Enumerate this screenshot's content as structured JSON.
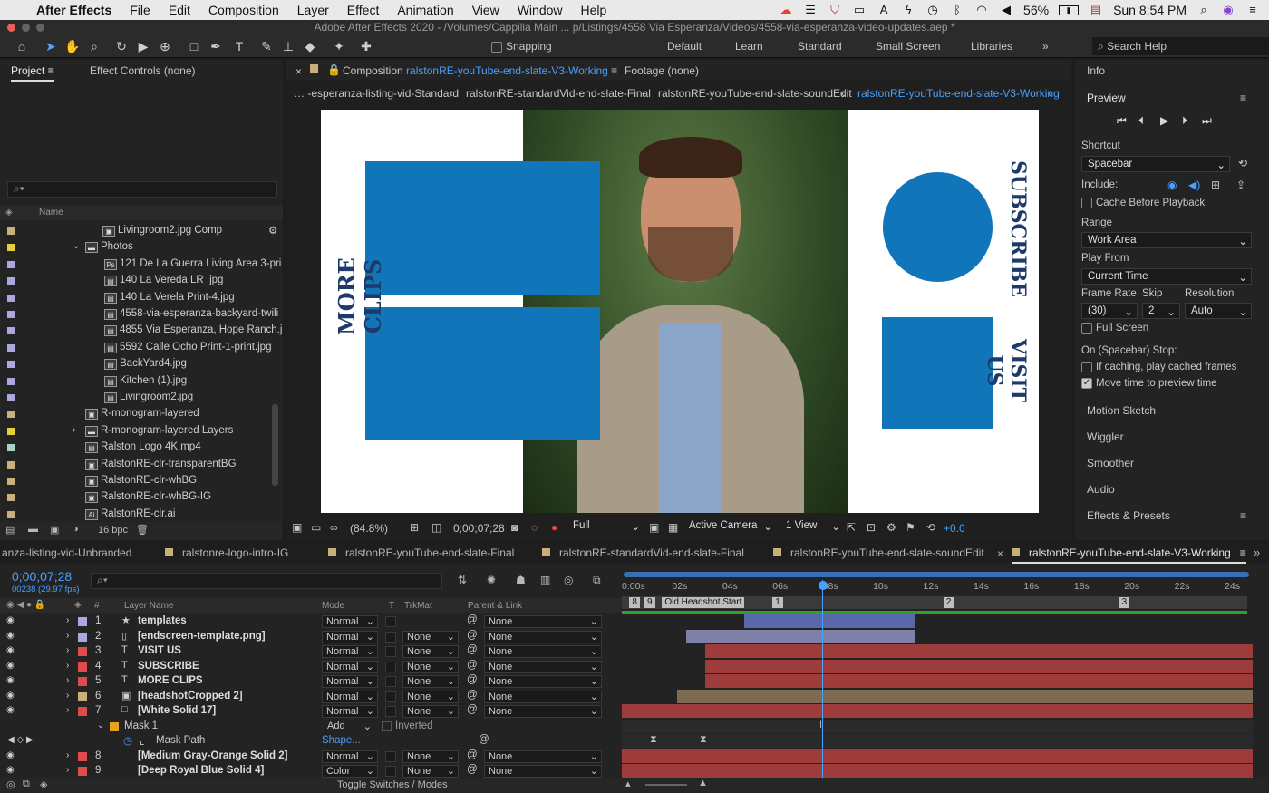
{
  "menubar": {
    "app": "After Effects",
    "items": [
      "File",
      "Edit",
      "Composition",
      "Layer",
      "Effect",
      "Animation",
      "View",
      "Window",
      "Help"
    ],
    "battery": "56%",
    "clock": "Sun 8:54 PM"
  },
  "window_title": "Adobe After Effects 2020 - /Volumes/Cappilla Main ... p/Listings/4558 Via Esperanza/Videos/4558-via-esperanza-video-updates.aep *",
  "toolbar": {
    "snapping": "Snapping",
    "workspaces": [
      "Default",
      "Learn",
      "Standard",
      "Small Screen",
      "Libraries"
    ],
    "search_help": "Search Help"
  },
  "project_panel": {
    "tab_project": "Project",
    "tab_effect_controls": "Effect Controls (none)",
    "col_name": "Name",
    "bpc": "16 bpc",
    "items": [
      {
        "name": "Livingroom2.jpg Comp",
        "color": "#c9b07a",
        "type": "comp",
        "indent": 1
      },
      {
        "name": "Photos",
        "color": "#e6cf3c",
        "type": "folder",
        "indent": 0
      },
      {
        "name": "121 De La Guerra Living Area 3-pri",
        "color": "#a9a9e0",
        "type": "psd",
        "indent": 2
      },
      {
        "name": "140 La Vereda LR .jpg",
        "color": "#a9a9e0",
        "type": "file",
        "indent": 2
      },
      {
        "name": "140 La Verela Print-4.jpg",
        "color": "#a9a9e0",
        "type": "file",
        "indent": 2
      },
      {
        "name": "4558-via-esperanza-backyard-twili",
        "color": "#a9a9e0",
        "type": "file",
        "indent": 2
      },
      {
        "name": "4855 Via Esperanza, Hope Ranch.jp",
        "color": "#a9a9e0",
        "type": "file",
        "indent": 2
      },
      {
        "name": "5592 Calle Ocho Print-1-print.jpg",
        "color": "#a9a9e0",
        "type": "file",
        "indent": 2
      },
      {
        "name": "BackYard4.jpg",
        "color": "#a9a9e0",
        "type": "file",
        "indent": 2
      },
      {
        "name": "Kitchen (1).jpg",
        "color": "#a9a9e0",
        "type": "file",
        "indent": 2
      },
      {
        "name": "Livingroom2.jpg",
        "color": "#a9a9e0",
        "type": "file",
        "indent": 2
      },
      {
        "name": "R-monogram-layered",
        "color": "#c9b07a",
        "type": "comp",
        "indent": 0
      },
      {
        "name": "R-monogram-layered Layers",
        "color": "#e6cf3c",
        "type": "folder",
        "indent": 0
      },
      {
        "name": "Ralston Logo 4K.mp4",
        "color": "#a7d2c9",
        "type": "file",
        "indent": 0
      },
      {
        "name": "RalstonRE-clr-transparentBG",
        "color": "#c9b07a",
        "type": "comp",
        "indent": 0
      },
      {
        "name": "RalstonRE-clr-whBG",
        "color": "#c9b07a",
        "type": "comp",
        "indent": 0
      },
      {
        "name": "RalstonRE-clr-whBG-IG",
        "color": "#c9b07a",
        "type": "comp",
        "indent": 0
      },
      {
        "name": "RalstonRE-clr.ai",
        "color": "#c9b07a",
        "type": "ai",
        "indent": 0
      }
    ]
  },
  "comp_panel": {
    "tab_label": "Composition",
    "comp_name": "ralstonRE-youTube-end-slate-V3-Working",
    "footage": "Footage (none)",
    "breadcrumbs": [
      "-esperanza-listing-vid-Standard",
      "ralstonRE-standardVid-end-slate-Final",
      "ralstonRE-youTube-end-slate-soundEdit",
      "ralstonRE-youTube-end-slate-V3-Working"
    ],
    "slate": {
      "more_clips": "MORE CLIPS",
      "subscribe": "SUBSCRIBE",
      "visit_us": "VISIT US",
      "blue": "#1176b9"
    },
    "footer": {
      "zoom": "(84.8%)",
      "time": "0;00;07;28",
      "resolution": "Full",
      "camera": "Active Camera",
      "views": "1 View",
      "exposure": "+0.0"
    }
  },
  "right_panel": {
    "info": "Info",
    "preview": "Preview",
    "shortcut_label": "Shortcut",
    "shortcut": "Spacebar",
    "include": "Include:",
    "cache_before": "Cache Before Playback",
    "range_label": "Range",
    "range": "Work Area",
    "play_from_label": "Play From",
    "play_from": "Current Time",
    "frame_rate_label": "Frame Rate",
    "skip_label": "Skip",
    "resolution_label": "Resolution",
    "frame_rate": "(30)",
    "skip": "2",
    "resolution": "Auto",
    "full_screen": "Full Screen",
    "on_stop": "On (Spacebar) Stop:",
    "if_caching": "If caching, play cached frames",
    "move_time": "Move time to preview time",
    "sections": [
      "Motion Sketch",
      "Wiggler",
      "Smoother",
      "Audio"
    ],
    "effects_presets": "Effects & Presets"
  },
  "timeline": {
    "tabs": [
      "anza-listing-vid-Unbranded",
      "ralstonre-logo-intro-IG",
      "ralstonRE-youTube-end-slate-Final",
      "ralstonRE-standardVid-end-slate-Final",
      "ralstonRE-youTube-end-slate-soundEdit",
      "ralstonRE-youTube-end-slate-V3-Working"
    ],
    "timecode": "0;00;07;28",
    "frames": "00238 (29.97 fps)",
    "cols": {
      "hash": "#",
      "layer_name": "Layer Name",
      "mode": "Mode",
      "t": "T",
      "trkmat": "TrkMat",
      "parent": "Parent & Link"
    },
    "ruler": [
      "0:00s",
      "02s",
      "04s",
      "06s",
      "08s",
      "10s",
      "12s",
      "14s",
      "16s",
      "18s",
      "20s",
      "22s",
      "24s"
    ],
    "markers": [
      "8",
      "9",
      "Old Headshot Start",
      "1",
      "2",
      "3"
    ],
    "layers": [
      {
        "num": "1",
        "name": "templates",
        "color": "#a9a9e0",
        "mode": "Normal",
        "trkmat": "",
        "parent": "None",
        "icon": "★"
      },
      {
        "num": "2",
        "name": "[endscreen-template.png]",
        "color": "#a9a9e0",
        "mode": "Normal",
        "trkmat": "None",
        "parent": "None",
        "icon": "▯"
      },
      {
        "num": "3",
        "name": "VISIT US",
        "color": "#e04a4a",
        "mode": "Normal",
        "trkmat": "None",
        "parent": "None",
        "icon": "T"
      },
      {
        "num": "4",
        "name": "SUBSCRIBE",
        "color": "#e04a4a",
        "mode": "Normal",
        "trkmat": "None",
        "parent": "None",
        "icon": "T"
      },
      {
        "num": "5",
        "name": "MORE CLIPS",
        "color": "#e04a4a",
        "mode": "Normal",
        "trkmat": "None",
        "parent": "None",
        "icon": "T"
      },
      {
        "num": "6",
        "name": "[headshotCropped 2]",
        "color": "#c9b07a",
        "mode": "Normal",
        "trkmat": "None",
        "parent": "None",
        "icon": "▣"
      },
      {
        "num": "7",
        "name": "[White Solid 17]",
        "color": "#e04a4a",
        "mode": "Normal",
        "trkmat": "None",
        "parent": "None",
        "icon": "□"
      }
    ],
    "mask": {
      "name": "Mask 1",
      "mode": "Add",
      "inverted": "Inverted",
      "path": "Mask Path",
      "shape": "Shape..."
    },
    "layers2": [
      {
        "num": "8",
        "name": "[Medium Gray-Orange Solid 2]",
        "color": "#e04a4a",
        "mode": "Normal",
        "trkmat": "None",
        "parent": "None"
      },
      {
        "num": "9",
        "name": "[Deep Royal Blue Solid 4]",
        "color": "#e04a4a",
        "mode": "Color",
        "trkmat": "None",
        "parent": "None"
      }
    ],
    "toggle": "Toggle Switches / Modes"
  }
}
